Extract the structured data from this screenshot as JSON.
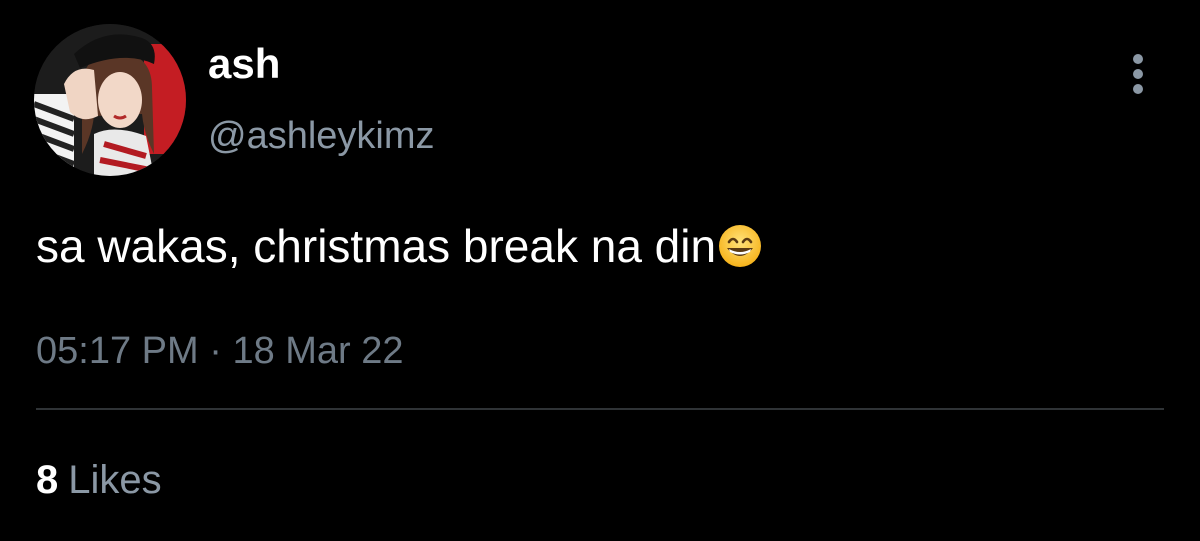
{
  "tweet": {
    "author": {
      "display_name": "ash",
      "handle": "@ashleykimz",
      "avatar_icon": "profile-photo"
    },
    "text": "sa wakas, christmas break na din",
    "emoji": "grinning-face-with-smiling-eyes",
    "time": "05:17 PM",
    "separator": "·",
    "date": "18 Mar 22",
    "likes": {
      "count": "8",
      "label": "Likes"
    },
    "more_icon": "more-vertical-icon"
  },
  "colors": {
    "background": "#000000",
    "primary_text": "#ffffff",
    "secondary_text": "#8b98a5",
    "divider": "#2f3336"
  }
}
